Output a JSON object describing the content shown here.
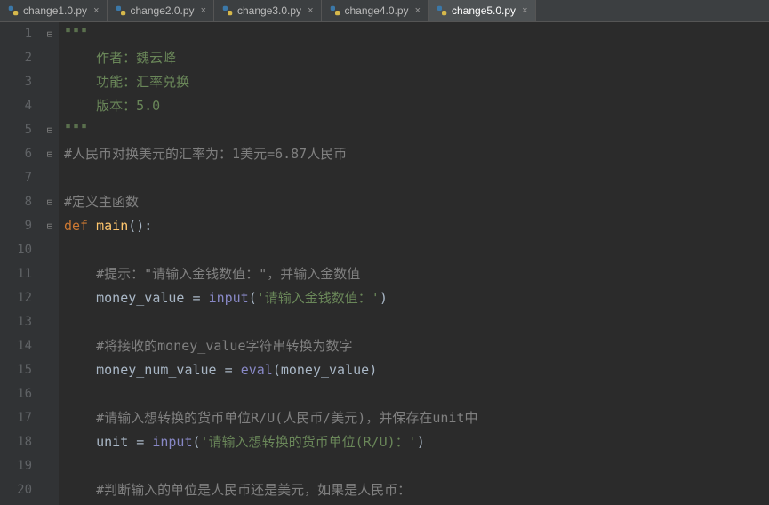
{
  "tabs": [
    {
      "label": "change1.0.py",
      "active": false
    },
    {
      "label": "change2.0.py",
      "active": false
    },
    {
      "label": "change3.0.py",
      "active": false
    },
    {
      "label": "change4.0.py",
      "active": false
    },
    {
      "label": "change5.0.py",
      "active": true
    }
  ],
  "close_glyph": "×",
  "lines": [
    {
      "n": 1,
      "fold": "⊟",
      "tokens": [
        {
          "cls": "tok-docstr",
          "t": "\"\"\""
        }
      ]
    },
    {
      "n": 2,
      "fold": "",
      "tokens": [
        {
          "cls": "",
          "t": "    "
        },
        {
          "cls": "tok-docstr",
          "t": "作者：魏云峰"
        }
      ]
    },
    {
      "n": 3,
      "fold": "",
      "tokens": [
        {
          "cls": "",
          "t": "    "
        },
        {
          "cls": "tok-docstr",
          "t": "功能：汇率兑换"
        }
      ]
    },
    {
      "n": 4,
      "fold": "",
      "tokens": [
        {
          "cls": "",
          "t": "    "
        },
        {
          "cls": "tok-docstr",
          "t": "版本：5.0"
        }
      ]
    },
    {
      "n": 5,
      "fold": "⊟",
      "tokens": [
        {
          "cls": "tok-docstr",
          "t": "\"\"\""
        }
      ]
    },
    {
      "n": 6,
      "fold": "⊟",
      "tokens": [
        {
          "cls": "tok-comment",
          "t": "#人民币对换美元的汇率为：1美元=6.87人民币"
        }
      ]
    },
    {
      "n": 7,
      "fold": "",
      "tokens": [
        {
          "cls": "",
          "t": ""
        }
      ]
    },
    {
      "n": 8,
      "fold": "⊟",
      "tokens": [
        {
          "cls": "tok-comment",
          "t": "#定义主函数"
        }
      ]
    },
    {
      "n": 9,
      "fold": "⊟",
      "tokens": [
        {
          "cls": "tok-keyword",
          "t": "def "
        },
        {
          "cls": "tok-func",
          "t": "main"
        },
        {
          "cls": "tok-op",
          "t": "():"
        }
      ]
    },
    {
      "n": 10,
      "fold": "",
      "tokens": [
        {
          "cls": "",
          "t": ""
        }
      ]
    },
    {
      "n": 11,
      "fold": "",
      "tokens": [
        {
          "cls": "",
          "t": "    "
        },
        {
          "cls": "tok-comment",
          "t": "#提示：\"请输入金钱数值：\"，并输入金数值"
        }
      ]
    },
    {
      "n": 12,
      "fold": "",
      "tokens": [
        {
          "cls": "",
          "t": "    "
        },
        {
          "cls": "tok-ident",
          "t": "money_value "
        },
        {
          "cls": "tok-op",
          "t": "= "
        },
        {
          "cls": "tok-builtin",
          "t": "input"
        },
        {
          "cls": "tok-op",
          "t": "("
        },
        {
          "cls": "tok-string",
          "t": "'请输入金钱数值：'"
        },
        {
          "cls": "tok-op",
          "t": ")"
        }
      ]
    },
    {
      "n": 13,
      "fold": "",
      "tokens": [
        {
          "cls": "",
          "t": ""
        }
      ]
    },
    {
      "n": 14,
      "fold": "",
      "tokens": [
        {
          "cls": "",
          "t": "    "
        },
        {
          "cls": "tok-comment",
          "t": "#将接收的money_value字符串转换为数字"
        }
      ]
    },
    {
      "n": 15,
      "fold": "",
      "tokens": [
        {
          "cls": "",
          "t": "    "
        },
        {
          "cls": "tok-ident",
          "t": "money_num_value "
        },
        {
          "cls": "tok-op",
          "t": "= "
        },
        {
          "cls": "tok-builtin",
          "t": "eval"
        },
        {
          "cls": "tok-op",
          "t": "("
        },
        {
          "cls": "tok-ident",
          "t": "money_value"
        },
        {
          "cls": "tok-op",
          "t": ")"
        }
      ]
    },
    {
      "n": 16,
      "fold": "",
      "tokens": [
        {
          "cls": "",
          "t": ""
        }
      ]
    },
    {
      "n": 17,
      "fold": "",
      "tokens": [
        {
          "cls": "",
          "t": "    "
        },
        {
          "cls": "tok-comment",
          "t": "#请输入想转换的货币单位R/U(人民币/美元)，并保存在unit中"
        }
      ]
    },
    {
      "n": 18,
      "fold": "",
      "tokens": [
        {
          "cls": "",
          "t": "    "
        },
        {
          "cls": "tok-ident",
          "t": "unit "
        },
        {
          "cls": "tok-op",
          "t": "= "
        },
        {
          "cls": "tok-builtin",
          "t": "input"
        },
        {
          "cls": "tok-op",
          "t": "("
        },
        {
          "cls": "tok-string",
          "t": "'请输入想转换的货币单位(R/U)：'"
        },
        {
          "cls": "tok-op",
          "t": ")"
        }
      ]
    },
    {
      "n": 19,
      "fold": "",
      "tokens": [
        {
          "cls": "",
          "t": ""
        }
      ]
    },
    {
      "n": 20,
      "fold": "",
      "tokens": [
        {
          "cls": "",
          "t": "    "
        },
        {
          "cls": "tok-comment",
          "t": "#判断输入的单位是人民币还是美元，如果是人民币："
        }
      ]
    }
  ]
}
